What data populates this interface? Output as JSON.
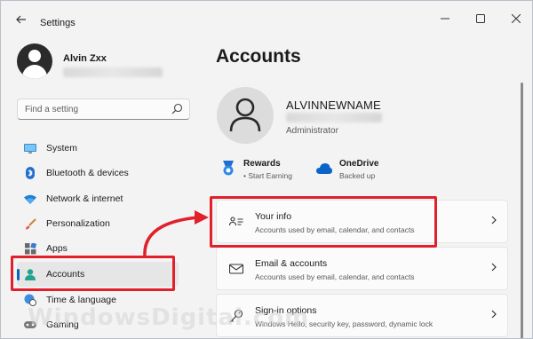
{
  "window": {
    "title": "Settings"
  },
  "profile": {
    "name": "Alvin Zxx"
  },
  "search": {
    "placeholder": "Find a setting"
  },
  "sidebar": {
    "items": [
      {
        "label": "System",
        "icon": "monitor-icon"
      },
      {
        "label": "Bluetooth & devices",
        "icon": "bluetooth-icon"
      },
      {
        "label": "Network & internet",
        "icon": "wifi-icon"
      },
      {
        "label": "Personalization",
        "icon": "brush-icon"
      },
      {
        "label": "Apps",
        "icon": "apps-icon"
      },
      {
        "label": "Accounts",
        "icon": "person-icon",
        "active": true
      },
      {
        "label": "Time & language",
        "icon": "globe-clock-icon"
      },
      {
        "label": "Gaming",
        "icon": "gamepad-icon"
      }
    ]
  },
  "main": {
    "page_title": "Accounts",
    "account": {
      "name": "ALVINNEWNAME",
      "role": "Administrator"
    },
    "rewards": {
      "title": "Rewards",
      "subtitle": "• Start Earning"
    },
    "onedrive": {
      "title": "OneDrive",
      "subtitle": "Backed up"
    },
    "cards": [
      {
        "title": "Your info",
        "subtitle": "Accounts used by email, calendar, and contacts",
        "icon": "id-card-icon"
      },
      {
        "title": "Email & accounts",
        "subtitle": "Accounts used by email, calendar, and contacts",
        "icon": "envelope-icon"
      },
      {
        "title": "Sign-in options",
        "subtitle": "Windows Hello, security key, password, dynamic lock",
        "icon": "key-icon"
      }
    ]
  },
  "watermark": "WindowsDigital.com",
  "colors": {
    "accent": "#0067c0",
    "highlight": "#e0202a",
    "window_bg": "#f3f3f3"
  }
}
